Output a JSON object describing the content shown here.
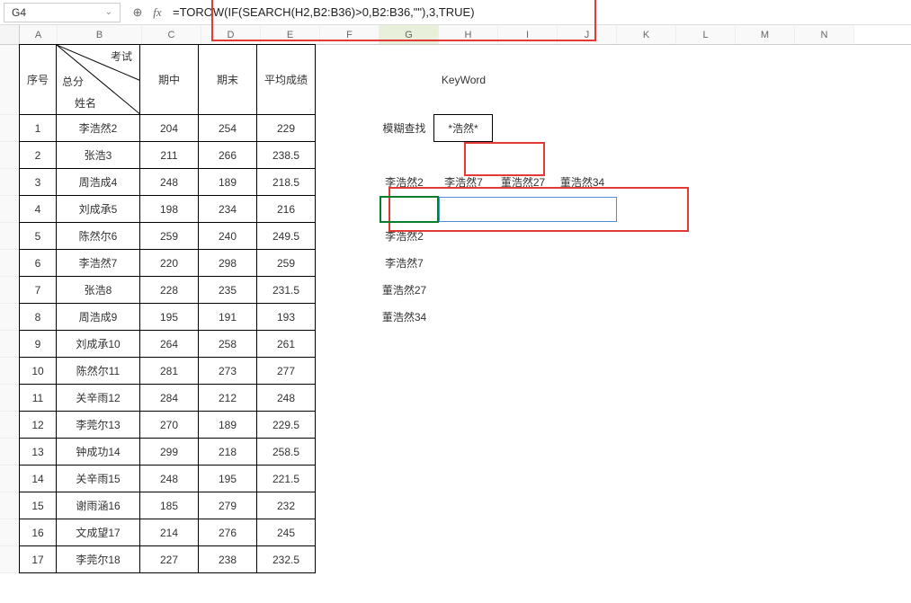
{
  "cell_ref": "G4",
  "formula": "=TOROW(IF(SEARCH(H2,B2:B36)>0,B2:B36,\"\"),3,TRUE)",
  "col_headers": [
    "A",
    "B",
    "C",
    "D",
    "E",
    "F",
    "G",
    "H",
    "I",
    "J",
    "K",
    "L",
    "M",
    "N"
  ],
  "header": {
    "a": "序号",
    "b_top": "考试",
    "b_mid": "总分",
    "b_bot": "姓名",
    "c": "期中",
    "d": "期末",
    "e": "平均成绩",
    "h_keyword": "KeyWord"
  },
  "search": {
    "label": "模糊查找",
    "value": "*浩然*"
  },
  "result_row": [
    "李浩然2",
    "李浩然7",
    "董浩然27",
    "董浩然34"
  ],
  "result_col": [
    "李浩然2",
    "李浩然7",
    "董浩然27",
    "董浩然34"
  ],
  "rows": [
    {
      "n": "1",
      "name": "李浩然2",
      "c": "204",
      "d": "254",
      "e": "229"
    },
    {
      "n": "2",
      "name": "张浩3",
      "c": "211",
      "d": "266",
      "e": "238.5"
    },
    {
      "n": "3",
      "name": "周浩成4",
      "c": "248",
      "d": "189",
      "e": "218.5"
    },
    {
      "n": "4",
      "name": "刘成承5",
      "c": "198",
      "d": "234",
      "e": "216"
    },
    {
      "n": "5",
      "name": "陈然尔6",
      "c": "259",
      "d": "240",
      "e": "249.5"
    },
    {
      "n": "6",
      "name": "李浩然7",
      "c": "220",
      "d": "298",
      "e": "259"
    },
    {
      "n": "7",
      "name": "张浩8",
      "c": "228",
      "d": "235",
      "e": "231.5"
    },
    {
      "n": "8",
      "name": "周浩成9",
      "c": "195",
      "d": "191",
      "e": "193"
    },
    {
      "n": "9",
      "name": "刘成承10",
      "c": "264",
      "d": "258",
      "e": "261"
    },
    {
      "n": "10",
      "name": "陈然尔11",
      "c": "281",
      "d": "273",
      "e": "277"
    },
    {
      "n": "11",
      "name": "关辛雨12",
      "c": "284",
      "d": "212",
      "e": "248"
    },
    {
      "n": "12",
      "name": "李莞尔13",
      "c": "270",
      "d": "189",
      "e": "229.5"
    },
    {
      "n": "13",
      "name": "钟成功14",
      "c": "299",
      "d": "218",
      "e": "258.5"
    },
    {
      "n": "14",
      "name": "关辛雨15",
      "c": "248",
      "d": "195",
      "e": "221.5"
    },
    {
      "n": "15",
      "name": "谢雨涵16",
      "c": "185",
      "d": "279",
      "e": "232"
    },
    {
      "n": "16",
      "name": "文成望17",
      "c": "214",
      "d": "276",
      "e": "245"
    },
    {
      "n": "17",
      "name": "李莞尔18",
      "c": "227",
      "d": "238",
      "e": "232.5"
    }
  ]
}
